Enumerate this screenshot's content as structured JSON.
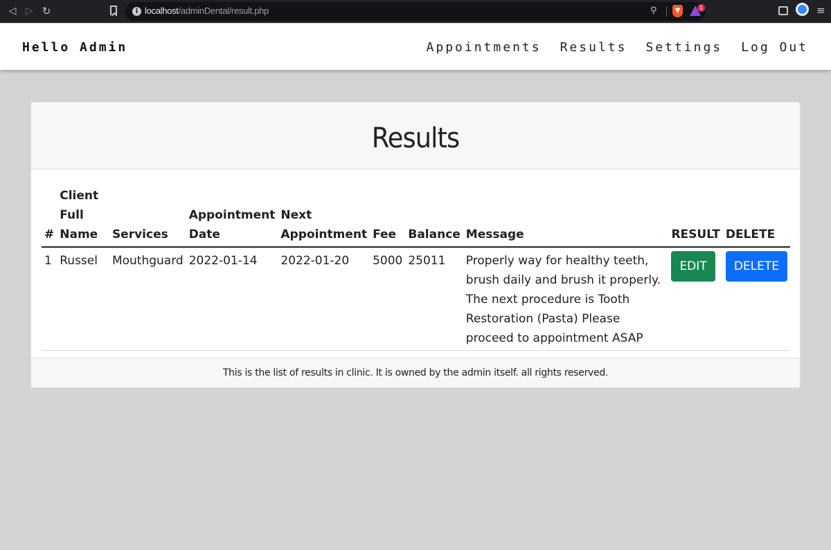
{
  "browser": {
    "url_host": "localhost",
    "url_path": "/adminDental/result.php",
    "rewards_badge": "1"
  },
  "navbar": {
    "brand": "Hello Admin",
    "links": [
      "Appointments",
      "Results",
      "Settings",
      "Log Out"
    ]
  },
  "card": {
    "title": "Results",
    "footer": "This is the list of results in clinic. It is owned by the admin itself. all rights reserved."
  },
  "table": {
    "headers": [
      "#",
      "Client Full Name",
      "Services",
      "Appointment Date",
      "Next Appointment",
      "Fee",
      "Balance",
      "Message",
      "RESULT",
      "DELETE"
    ],
    "rows": [
      {
        "num": "1",
        "client": "Russel",
        "service": "Mouthguard",
        "appointment_date": "2022-01-14",
        "next_appointment": "2022-01-20",
        "fee": "5000",
        "balance": "25011",
        "message": "Properly way for healthy teeth, brush daily and brush it properly. The next procedure is Tooth Restoration (Pasta) Please proceed to appointment ASAP",
        "edit_label": "EDIT",
        "delete_label": "DELETE"
      }
    ]
  },
  "colors": {
    "edit_button": "#198754",
    "delete_button": "#0d6efd",
    "page_background": "#d3d3d3"
  }
}
